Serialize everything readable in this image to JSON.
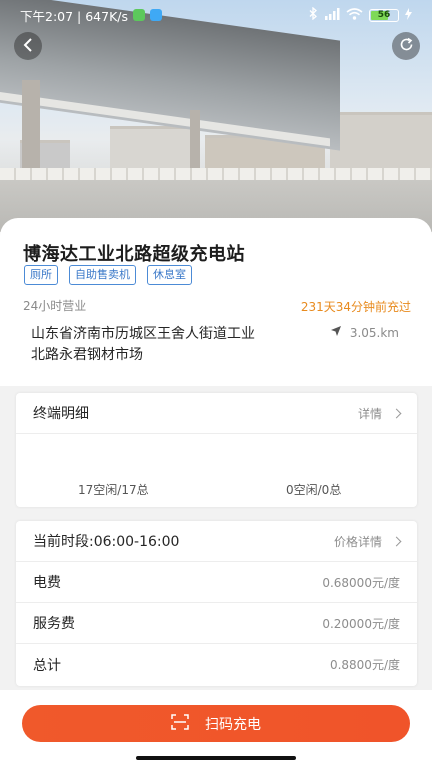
{
  "status_bar": {
    "time_speed": "下午2:07 | 647K/s",
    "battery": "56"
  },
  "station": {
    "name": "博海达工业北路超级充电站",
    "tags": [
      "厕所",
      "自助售卖机",
      "休息室"
    ],
    "hours": "24小时营业",
    "last_charged": "231天34分钟前充过",
    "address": "山东省济南市历城区王舍人街道工业北路永君钢材市场",
    "distance": "3.05.km"
  },
  "terminals": {
    "title": "终端明细",
    "detail_label": "详情",
    "fast_count": "17空闲/17总",
    "slow_count": "0空闲/0总"
  },
  "pricing": {
    "period_label": "当前时段:06:00-16:00",
    "detail_label": "价格详情",
    "items": [
      {
        "label": "电费",
        "value": "0.68000元/度"
      },
      {
        "label": "服务费",
        "value": "0.20000元/度"
      },
      {
        "label": "总计",
        "value": "0.8800元/度"
      }
    ]
  },
  "action": {
    "scan_label": "扫码充电"
  },
  "colors": {
    "accent": "#f0592b",
    "tag": "#3a78c8",
    "highlight": "#e88b1f"
  }
}
